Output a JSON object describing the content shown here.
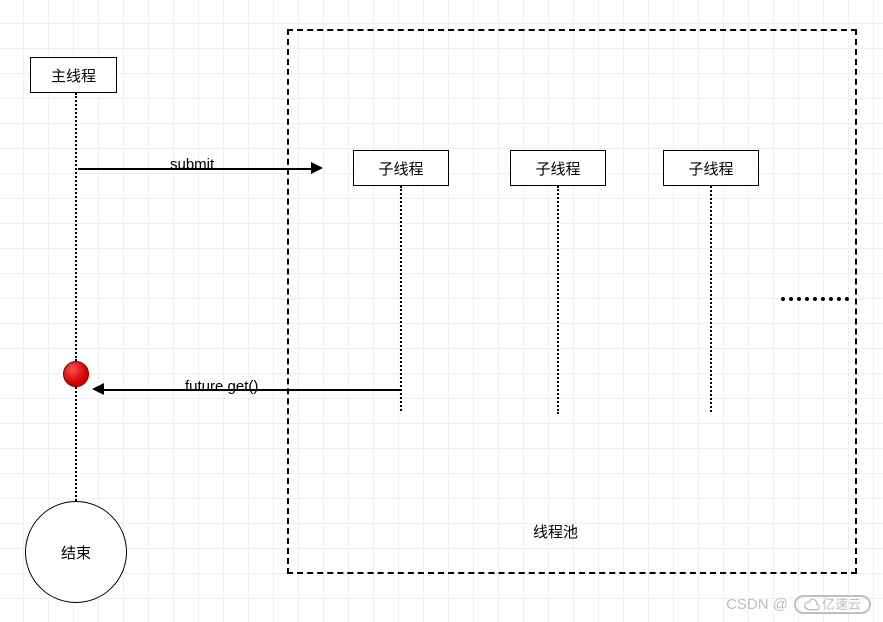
{
  "nodes": {
    "main_thread": "主线程",
    "child_thread_1": "子线程",
    "child_thread_2": "子线程",
    "child_thread_3": "子线程",
    "end": "结束",
    "pool_label": "线程池"
  },
  "edges": {
    "submit": "submit",
    "future_get": "future.get()"
  },
  "watermark": {
    "csdn": "CSDN @",
    "brand": "亿速云"
  }
}
